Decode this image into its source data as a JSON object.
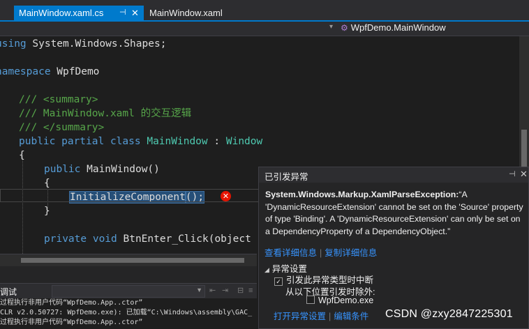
{
  "tabs": {
    "active": {
      "label": "MainWindow.xaml.cs",
      "pin": "⊣",
      "close": "✕"
    },
    "inactive": {
      "label": "MainWindow.xaml"
    }
  },
  "navbar": {
    "member": "WpfDemo.MainWindow",
    "dropdown": "▾"
  },
  "code": {
    "l1_kw": "using",
    "l1_rest": " System.Windows.Shapes;",
    "l2_kw": "namespace",
    "l2_rest": " WpfDemo",
    "l3": "/// <summary>",
    "l4": "/// MainWindow.xaml 的交互逻辑",
    "l5": "/// </summary>",
    "l6_kw": "public partial class",
    "l6_type": "MainWindow",
    "l6_colon": " : ",
    "l6_base": "Window",
    "l7": "{",
    "l8_kw": "public",
    "l8_rest": " MainWindow()",
    "l9": "{",
    "l10_hl": "InitializeComponent",
    "l10_rest": "();",
    "l11": "}",
    "l12_kw": "private void",
    "l12_rest": " BtnEnter_Click(object"
  },
  "output": {
    "title": "调试",
    "lines": [
      "过程执行非用户代码“WpfDemo.App..ctor”",
      "CLR v2.0.50727: WpfDemo.exe): 已加载“C:\\Windows\\assembly\\GAC_",
      "过程执行非用户代码“WpfDemo.App..ctor”"
    ]
  },
  "popup": {
    "title": "已引发异常",
    "exception": "System.Windows.Markup.XamlParseException:",
    "message": "“A 'DynamicResourceExtension' cannot be set on the 'Source' property of type 'Binding'. A 'DynamicResourceExtension' can only be set on a DependencyProperty of a DependencyObject.”",
    "link_details": "查看详细信息",
    "link_copy": "复制详细信息",
    "section": "异常设置",
    "option_break": "引发此异常类型时中断",
    "option_except": "从以下位置引发时除外:",
    "option_exe": "WpfDemo.exe",
    "link_open": "打开异常设置",
    "link_edit": "编辑条件",
    "pin": "⊣",
    "close": "✕"
  },
  "watermark": "CSDN @zxy2847225301",
  "colors": {
    "accent": "#007acc",
    "error": "#e51400",
    "link": "#3794ff"
  }
}
